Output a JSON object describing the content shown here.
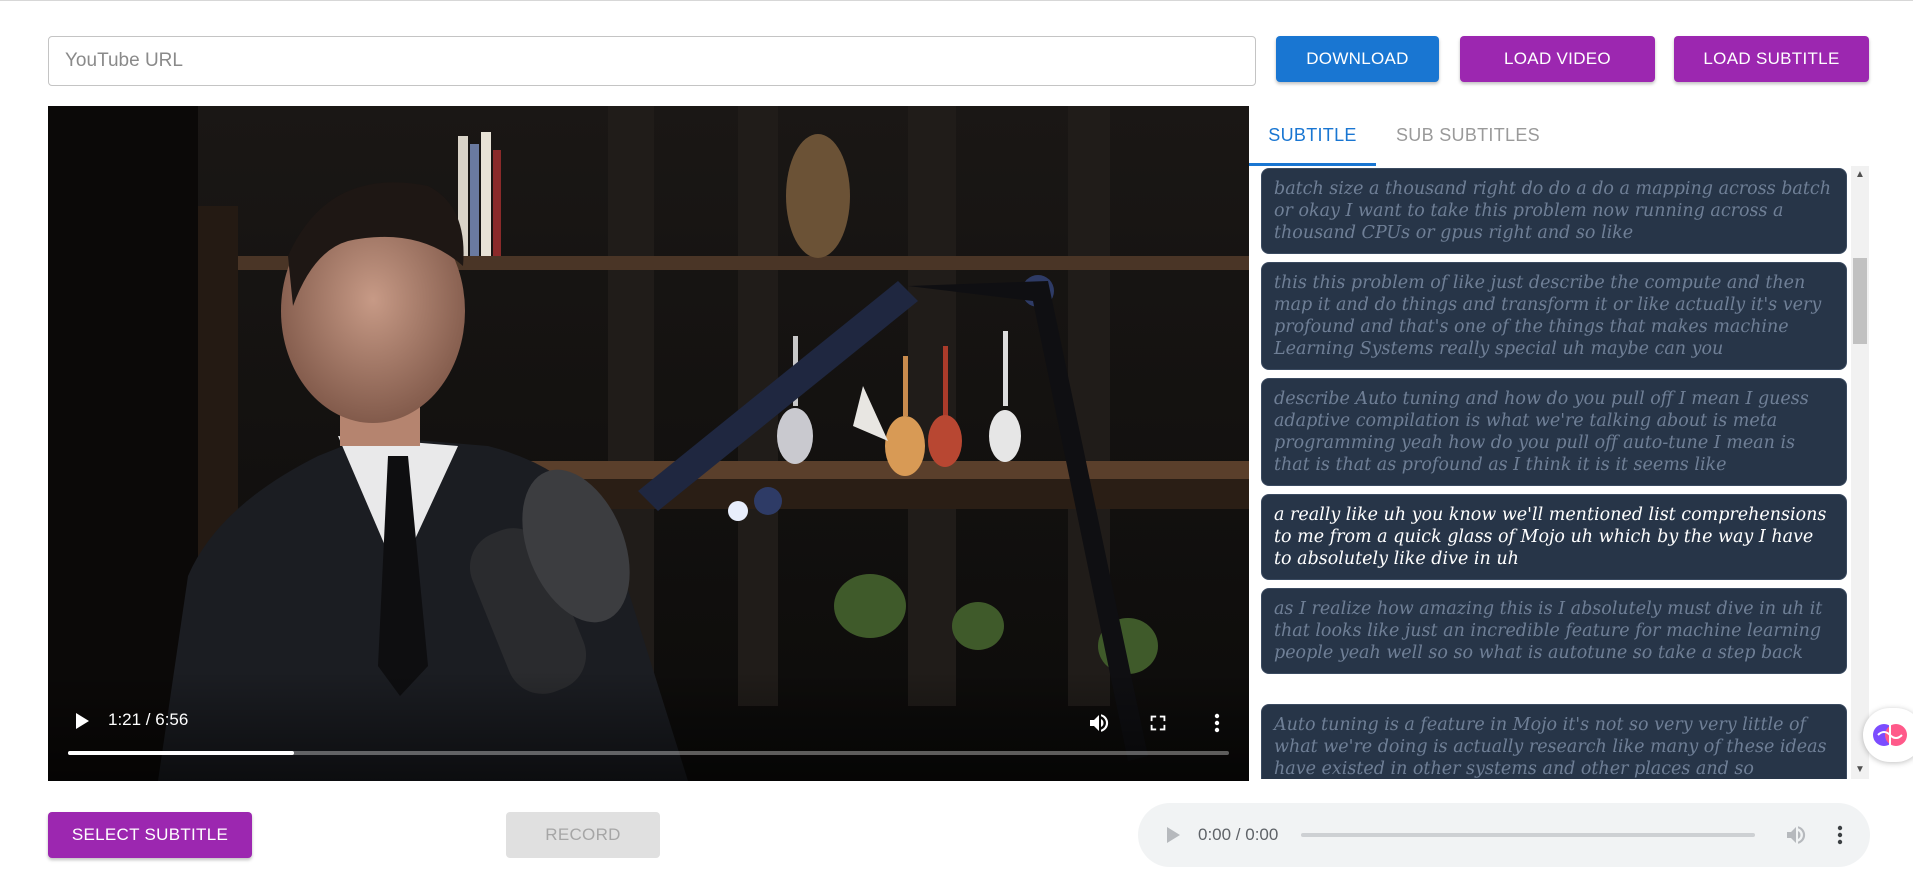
{
  "top": {
    "url_placeholder": "YouTube URL",
    "url_value": "",
    "download_label": "DOWNLOAD",
    "load_video_label": "LOAD VIDEO",
    "load_subtitle_label": "LOAD SUBTITLE"
  },
  "video": {
    "time": "1:21 / 6:56",
    "progress": 0.195,
    "icons": [
      "play-icon",
      "volume-icon",
      "fullscreen-icon",
      "more-vert-icon"
    ]
  },
  "tabs": [
    {
      "label": "SUBTITLE",
      "active": true
    },
    {
      "label": "SUB SUBTITLES",
      "active": false
    }
  ],
  "subtitles": [
    {
      "text": "batch size a thousand right do do a do a mapping across batch or okay I want to take this problem now running across a thousand CPUs or gpus right and so like",
      "active": false
    },
    {
      "text": "this this problem of like just describe the compute and then map it and do things and transform it or like actually it's very profound and that's one of the things that makes machine Learning Systems really special uh maybe can you",
      "active": false
    },
    {
      "text": "describe Auto tuning and how do you pull off I mean I guess adaptive compilation is what we're talking about is meta programming yeah how do you pull off auto-tune I mean is that is that as profound as I think it is it seems like",
      "active": false
    },
    {
      "text": "a really like uh you know we'll mentioned list comprehensions to me from a quick glass of Mojo uh which by the way I have to absolutely like dive in uh",
      "active": true
    },
    {
      "text": "as I realize how amazing this is I absolutely must dive in uh it that looks like just an incredible feature for machine learning people yeah well so so what is autotune so take a step back",
      "active": false
    },
    {
      "text": "Auto tuning is a feature in Mojo it's not so very very little of what we're doing is actually research like many of these ideas have existed in other systems and other places and so",
      "active": false
    }
  ],
  "bottom": {
    "select_subtitle_label": "SELECT SUBTITLE",
    "record_label": "RECORD",
    "audio_time": "0:00 / 0:00"
  },
  "colors": {
    "primary": "#1976d2",
    "secondary": "#9c27b0",
    "subtitle_card": "#273548",
    "subtitle_inactive_text": "#6f7f96",
    "subtitle_active_text": "#ffffff"
  }
}
